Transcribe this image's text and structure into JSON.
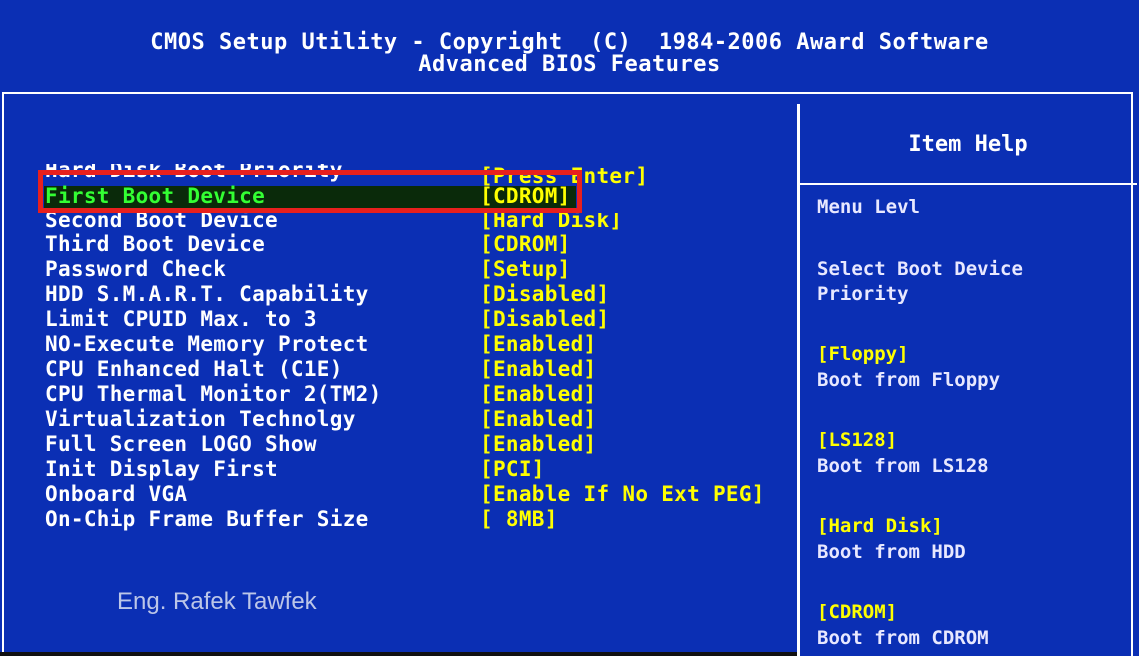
{
  "header": {
    "title": "CMOS Setup Utility - Copyright  (C)  1984-2006 Award Software",
    "subtitle": "Advanced BIOS Features"
  },
  "settings": [
    {
      "label": "Hard Disk Boot Priority",
      "value": "[Press Enter]"
    },
    {
      "label": "First Boot Device",
      "value": "[CDROM]"
    },
    {
      "label": "Second Boot Device",
      "value": "[Hard Disk]"
    },
    {
      "label": "Third Boot Device",
      "value": "[CDROM]"
    },
    {
      "label": "Password Check",
      "value": "[Setup]"
    },
    {
      "label": "HDD S.M.A.R.T. Capability",
      "value": "[Disabled]"
    },
    {
      "label": "Limit CPUID Max. to 3",
      "value": "[Disabled]"
    },
    {
      "label": "NO-Execute Memory Protect",
      "value": "[Enabled]"
    },
    {
      "label": "CPU Enhanced Halt (C1E)",
      "value": "[Enabled]"
    },
    {
      "label": "CPU Thermal Monitor 2(TM2)",
      "value": "[Enabled]"
    },
    {
      "label": "Virtualization Technolgy",
      "value": "[Enabled]"
    },
    {
      "label": "Full Screen LOGO Show",
      "value": "[Enabled]"
    },
    {
      "label": "Init Display First",
      "value": "[PCI]"
    },
    {
      "label": "Onboard VGA",
      "value": "[Enable If No Ext PEG]"
    },
    {
      "label": "On-Chip Frame Buffer Size",
      "value": "[ 8MB]"
    }
  ],
  "help": {
    "title": "Item Help",
    "menu_level": "Menu Levl",
    "description": [
      "Select Boot Device",
      "Priority"
    ],
    "options": [
      {
        "key": "[Floppy]",
        "desc": "Boot from Floppy"
      },
      {
        "key": "[LS128]",
        "desc": "Boot from LS128"
      },
      {
        "key": "[Hard Disk]",
        "desc": "Boot from HDD"
      },
      {
        "key": "[CDROM]",
        "desc": "Boot from CDROM"
      }
    ]
  },
  "watermark": "Eng. Rafek Tawfek",
  "colors": {
    "background": "#0b2fb4",
    "label": "#ffffff",
    "value": "#ffff00",
    "selected_label": "#33ff33",
    "highlight_box": "#e8201e"
  }
}
